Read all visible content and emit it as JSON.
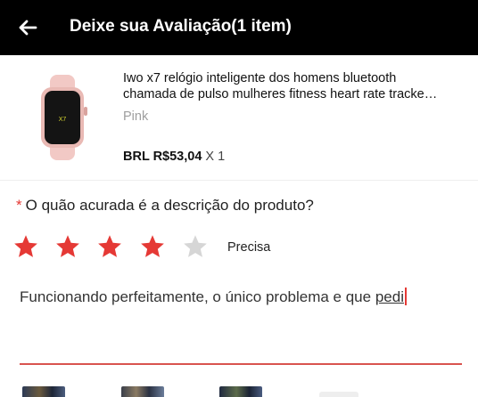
{
  "header": {
    "title": "Deixe sua Avaliação(1 item)",
    "back_icon": "arrow-left-icon"
  },
  "product": {
    "title_line1": "Iwo x7 relógio inteligente dos homens bluetooth",
    "title_line2": "chamada de pulso mulheres fitness heart rate tracke…",
    "variant": "Pink",
    "price": "BRL R$53,04",
    "quantity": "X 1",
    "screen_text": "X7"
  },
  "question": {
    "required_mark": "*",
    "text": "O quão acurada é a descrição do produto?"
  },
  "rating": {
    "value": 4,
    "max": 5,
    "label": "Precisa",
    "filled_color": "#e53935",
    "empty_color": "#d6d6d6"
  },
  "review": {
    "text": "Funcionando perfeitamente, o único problema e que ",
    "last_word": "pedi"
  },
  "colors": {
    "appbar": "#000000",
    "accent": "#e53935",
    "underline": "#d9534f"
  }
}
